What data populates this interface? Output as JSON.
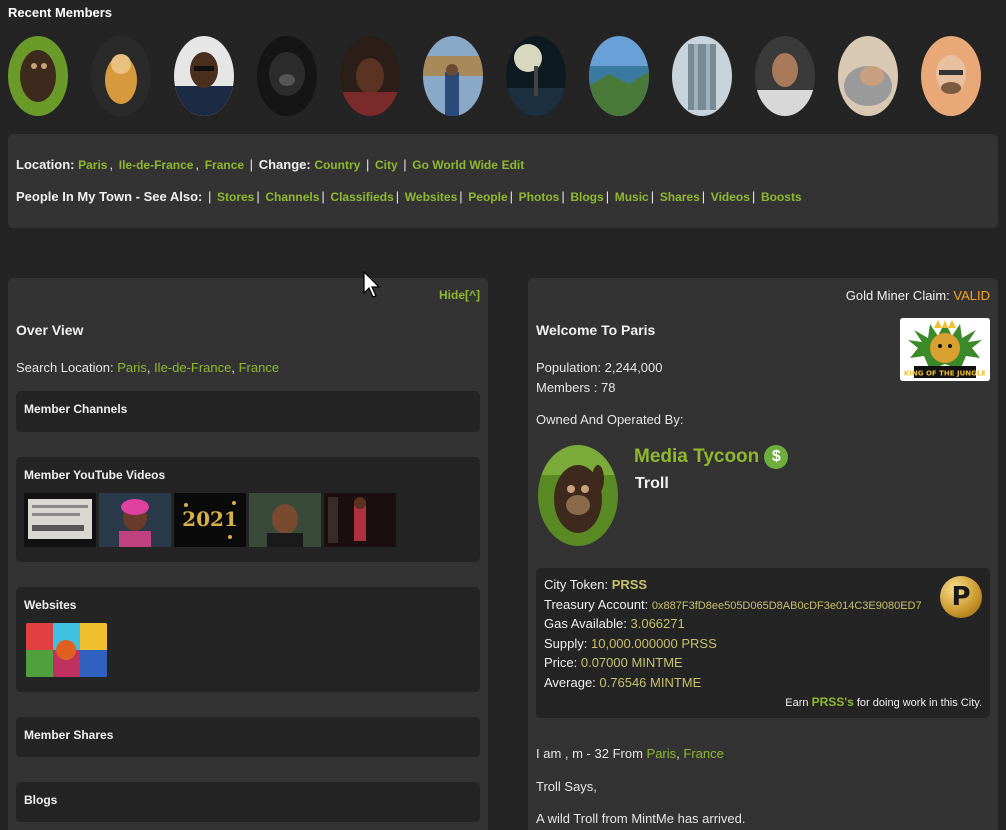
{
  "recent_members": {
    "title": "Recent Members",
    "avatars": [
      "member-1",
      "member-2",
      "member-3",
      "member-4",
      "member-5",
      "member-6",
      "member-7",
      "member-8",
      "member-9",
      "member-10",
      "member-11",
      "member-12"
    ]
  },
  "location": {
    "label": "Location:",
    "city": "Paris",
    "region": "Ile-de-France",
    "country": "France",
    "change_label": "Change:",
    "change_country": "Country",
    "change_city": "City",
    "go_world_wide": "Go World Wide",
    "edit": "Edit",
    "people_label": "People In My Town - See Also:",
    "see_also": [
      "Stores",
      "Channels",
      "Classifieds",
      "Websites",
      "People",
      "Photos",
      "Blogs",
      "Music",
      "Shares",
      "Videos",
      "Boosts"
    ]
  },
  "overview": {
    "hide": "Hide[^]",
    "heading": "Over View",
    "search_label": "Search Location:",
    "search_city": "Paris",
    "search_region": "Ile-de-France",
    "search_country": "France",
    "member_channels": "Member Channels",
    "member_videos": "Member YouTube Videos",
    "video_2021": "2021",
    "websites": "Websites",
    "member_shares": "Member Shares",
    "blogs": "Blogs"
  },
  "city": {
    "gold_claim_label": "Gold Miner Claim:",
    "gold_claim_status": "VALID",
    "welcome": "Welcome To Paris",
    "population": "Population: 2,244,000",
    "members": "Members : 78",
    "owned_by": "Owned And Operated By:",
    "owner_role": "Media Tycoon",
    "owner_name": "Troll",
    "logo_text": "KING OF THE JUNGLE"
  },
  "token": {
    "city_token_label": "City Token:",
    "city_token": "PRSS",
    "treasury_label": "Treasury Account:",
    "treasury": "0x887F3fD8ee505D065D8AB0cDF3e014C3E9080ED7",
    "gas_label": "Gas Available:",
    "gas": "3.066271",
    "supply_label": "Supply:",
    "supply": "10,000.000000 PRSS",
    "price_label": "Price:",
    "price": "0.07000 MINTME",
    "average_label": "Average:",
    "average": "0.76546 MINTME",
    "coin_letter": "P",
    "earn_prefix": "Earn",
    "earn_token": "PRSS's",
    "earn_suffix": "for doing work in this City."
  },
  "bio": {
    "prefix": "I am , m - 32 From",
    "city": "Paris",
    "country": "France",
    "says": "Troll Says,",
    "message": "A wild Troll from MintMe has arrived."
  },
  "colors": {
    "background": "#242424",
    "panel": "#333333",
    "link": "#8fb82f",
    "valid": "#f5a623",
    "token_value": "#c8c06a"
  }
}
